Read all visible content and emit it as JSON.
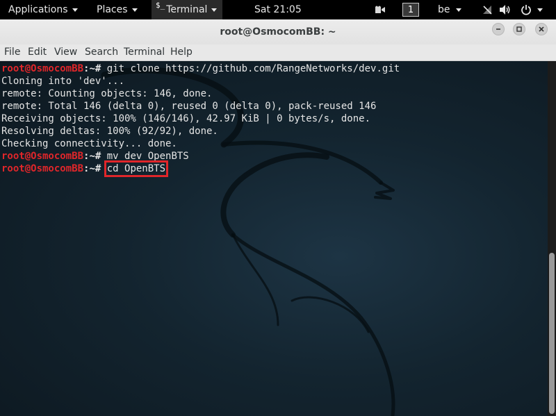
{
  "topbar": {
    "applications_label": "Applications",
    "places_label": "Places",
    "terminal_icon": "$_",
    "terminal_label": "Terminal",
    "clock": "Sat 21:05",
    "workspace_number": "1",
    "keyboard_layout": "be",
    "icons": [
      "camera-icon",
      "no-network-icon",
      "volume-icon",
      "power-icon"
    ]
  },
  "window": {
    "title": "root@OsmocomBB: ~",
    "buttons": [
      "minimize-icon",
      "maximize-icon",
      "close-icon"
    ]
  },
  "menubar": {
    "items": [
      "File",
      "Edit",
      "View",
      "Search",
      "Terminal",
      "Help"
    ]
  },
  "terminal": {
    "prompt_user": "root@OsmocomBB",
    "prompt_sep": ":~# ",
    "lines": [
      {
        "type": "command",
        "text": "git clone https://github.com/RangeNetworks/dev.git"
      },
      {
        "type": "output",
        "text": "Cloning into 'dev'..."
      },
      {
        "type": "output",
        "text": "remote: Counting objects: 146, done."
      },
      {
        "type": "output",
        "text": "remote: Total 146 (delta 0), reused 0 (delta 0), pack-reused 146"
      },
      {
        "type": "output",
        "text": "Receiving objects: 100% (146/146), 42.97 KiB | 0 bytes/s, done."
      },
      {
        "type": "output",
        "text": "Resolving deltas: 100% (92/92), done."
      },
      {
        "type": "output",
        "text": "Checking connectivity... done."
      },
      {
        "type": "command",
        "text": "mv dev OpenBTS"
      },
      {
        "type": "command",
        "text": "cd OpenBTS",
        "highlighted": true
      }
    ]
  },
  "colors": {
    "prompt": "#e0262a",
    "highlight_box": "#e0262a",
    "terminal_text": "#e5e5e5"
  }
}
